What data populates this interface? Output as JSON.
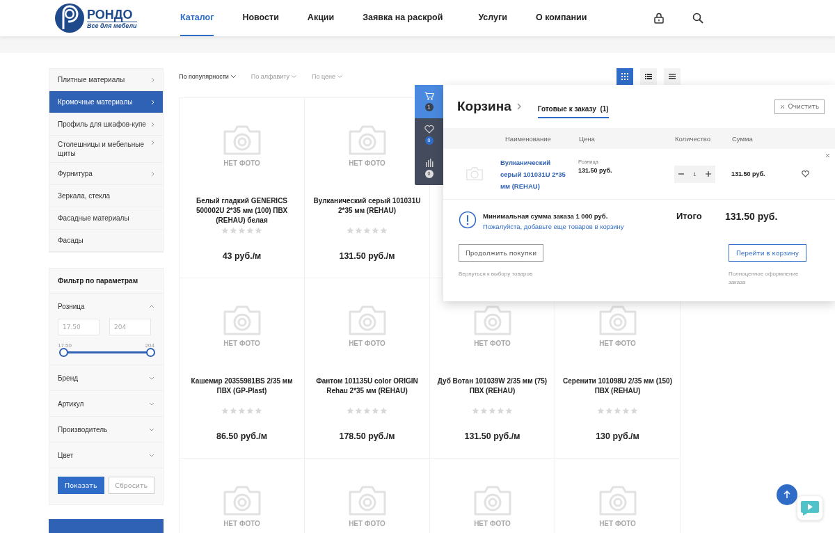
{
  "header": {
    "logo": {
      "name": "РОНДО",
      "tagline": "Все для мебели"
    },
    "nav": [
      {
        "label": "Каталог",
        "selected": true
      },
      {
        "label": "Новости",
        "selected": false
      },
      {
        "label": "Акции",
        "selected": false
      },
      {
        "label": "Заявка на раскрой",
        "selected": false
      },
      {
        "label": "Услуги",
        "selected": false
      },
      {
        "label": "О компании",
        "selected": false
      }
    ]
  },
  "sidebar": {
    "items": [
      {
        "label": "Плитные материалы",
        "has_arrow": true,
        "selected": false
      },
      {
        "label": "Кромочные материалы",
        "has_arrow": true,
        "selected": true
      },
      {
        "label": "Профиль для шкафов-купе",
        "has_arrow": true,
        "selected": false
      },
      {
        "label": "Столешницы и мебельные щиты",
        "has_arrow": true,
        "selected": false
      },
      {
        "label": "Фурнитура",
        "has_arrow": true,
        "selected": false
      },
      {
        "label": "Зеркала, стекла",
        "has_arrow": false,
        "selected": false
      },
      {
        "label": "Фасадные материалы",
        "has_arrow": false,
        "selected": false
      },
      {
        "label": "Фасады",
        "has_arrow": false,
        "selected": false
      }
    ]
  },
  "filter": {
    "title": "Фильтр по параметрам",
    "sections": [
      {
        "label": "Розница",
        "expanded": true,
        "from_placeholder": "17.50",
        "to_placeholder": "204",
        "min_label": "17.50",
        "max_label": "204",
        "level": 1
      },
      {
        "label": "Бренд",
        "expanded": false
      },
      {
        "label": "Артикул",
        "expanded": false
      },
      {
        "label": "Производитель",
        "expanded": false
      },
      {
        "label": "Цвет",
        "expanded": false
      }
    ],
    "buttons": [
      {
        "label": "Показать",
        "kind": "primary"
      },
      {
        "label": "Сбросить",
        "kind": "secondary"
      }
    ]
  },
  "sort": [
    {
      "label": "По популярности",
      "selected": true
    },
    {
      "label": "По алфавиту",
      "selected": false
    },
    {
      "label": "По цене",
      "selected": false
    }
  ],
  "view_modes": [
    {
      "kind": "tiles",
      "selected": true
    },
    {
      "kind": "list",
      "selected": false
    },
    {
      "kind": "table",
      "selected": false
    }
  ],
  "product_rows": [
    [
      {
        "photo_label": "НЕТ ФОТО",
        "name": "Белый гладкий GENERICS 500002U 2*35 мм (100) ПВХ (REHAU) белая",
        "stars": 0,
        "price": "43 руб./м"
      },
      {
        "photo_label": "НЕТ ФОТО",
        "name": "Вулканический серый 101031U 2*35 мм (REHAU)",
        "stars": 0,
        "price": "131.50 руб./м"
      }
    ],
    [
      {
        "photo_label": "НЕТ ФОТО",
        "name": "Кашемир 20355981BS 2/35 мм ПВХ (GP-Plast)",
        "stars": 0,
        "price": "86.50 руб./м"
      },
      {
        "photo_label": "НЕТ ФОТО",
        "name": "Фантом 101135U color ORIGIN Rehau 2*35 мм (REHAU)",
        "stars": 0,
        "price": "178.50 руб./м"
      },
      {
        "photo_label": "НЕТ ФОТО",
        "name": "Дуб Вотан 101039W 2/35 мм (75) ПВХ (REHAU)",
        "stars": 0,
        "price": "131.50 руб./м"
      },
      {
        "photo_label": "НЕТ ФОТО",
        "name": "Серенити 101098U 2/35 мм (150) ПВХ (REHAU)",
        "stars": 0,
        "price": "130 руб./м"
      }
    ],
    [
      {
        "photo_label": "НЕТ ФОТО"
      },
      {
        "photo_label": "НЕТ ФОТО"
      },
      {
        "photo_label": "НЕТ ФОТО"
      },
      {
        "photo_label": "НЕТ ФОТО"
      }
    ]
  ],
  "side_tabs": [
    {
      "kind": "cart",
      "count": "1",
      "selected": true
    },
    {
      "kind": "favorites",
      "count": "0",
      "selected": false
    },
    {
      "kind": "compare",
      "count": "0",
      "selected": false
    }
  ],
  "cart": {
    "title": "Корзина",
    "tab": "Готовые к заказу",
    "tab_count": "(1)",
    "clear": "Очистить",
    "columns": [
      "Наименование",
      "Цена",
      "Количество",
      "Сумма"
    ],
    "items": [
      {
        "name": "Вулканический серый 101031U 2*35 мм (REHAU)",
        "price_label": "Розница",
        "price": "131.50 руб.",
        "quantity": "1",
        "sum": "131.50 руб."
      }
    ],
    "notice": "Минимальная сумма заказа 1 000 руб.",
    "notice_link": "Пожалуйста, добавьте еще товаров в корзину",
    "total_label": "Итого",
    "total": "131.50 руб.",
    "continue": {
      "label": "Продолжить покупки",
      "hint": "Вернуться к выбору товаров"
    },
    "checkout": {
      "label": "Перейти в корзину",
      "hint": "Полноценное оформление заказа"
    }
  }
}
